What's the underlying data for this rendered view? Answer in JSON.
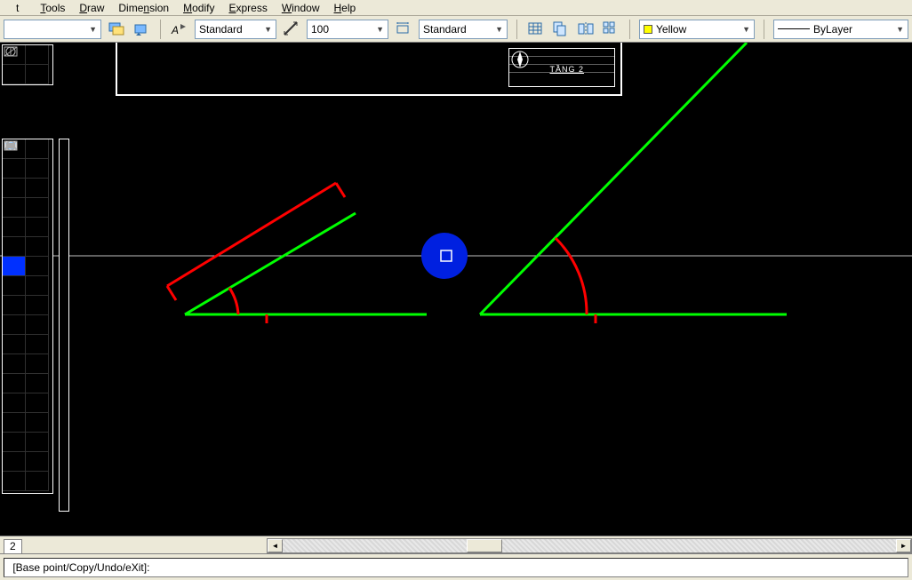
{
  "menu": {
    "items": [
      "t",
      "Tools",
      "Draw",
      "Dimension",
      "Modify",
      "Express",
      "Window",
      "Help"
    ],
    "ul": [
      "t",
      "T",
      "D",
      "D",
      "M",
      "E",
      "W",
      "H"
    ]
  },
  "toolbar": {
    "textstyle_dd": "Standard",
    "dimscale_dd": "100",
    "dimstyle_dd": "Standard",
    "color_dd": "Yellow",
    "linetype_dd": "ByLayer"
  },
  "canvas": {
    "title_label": "TẦNG 2"
  },
  "tabs": {
    "active": "2"
  },
  "command": {
    "prompt": " [Base point/Copy/Undo/eXit]:"
  }
}
